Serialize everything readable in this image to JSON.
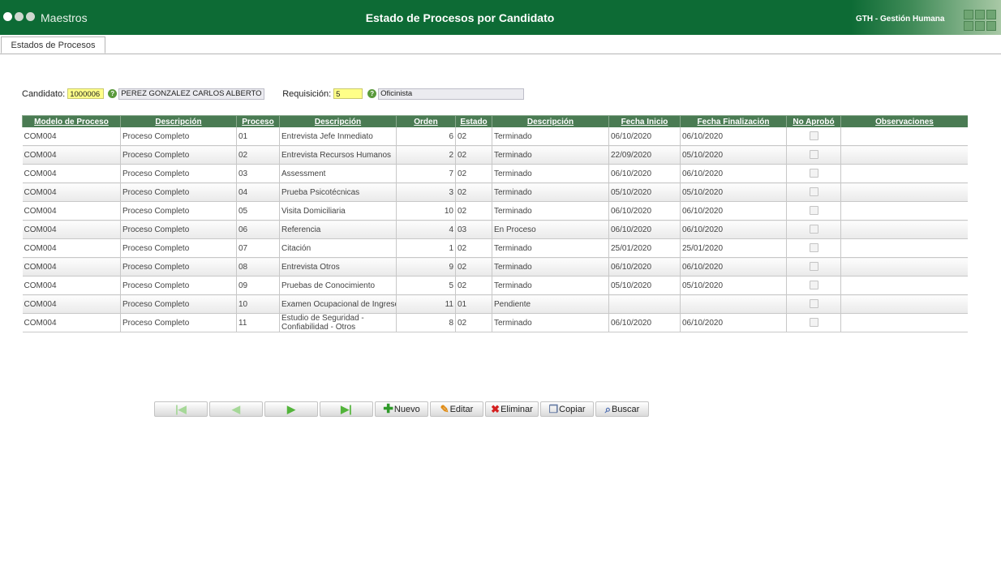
{
  "header": {
    "app_title": "Maestros",
    "page_title": "Estado de Procesos por Candidato",
    "brand": "GTH - Gestión Humana"
  },
  "tabs": [
    {
      "label": "Estados de Procesos"
    }
  ],
  "form": {
    "candidato_label": "Candidato:",
    "candidato_code": "1000006",
    "candidato_name": "PEREZ GONZALEZ CARLOS ALBERTO",
    "requisicion_label": "Requisición:",
    "requisicion_value": "5",
    "requisicion_desc": "Oficinista"
  },
  "grid": {
    "columns": [
      "Modelo de Proceso",
      "Descripción",
      "Proceso",
      "Descripción",
      "Orden",
      "Estado",
      "Descripción",
      "Fecha Inicio",
      "Fecha Finalización",
      "No Aprobó",
      "Observaciones"
    ],
    "rows": [
      {
        "modelo": "COM004",
        "desc_modelo": "Proceso Completo",
        "proceso": "01",
        "desc_proceso": "Entrevista Jefe Inmediato",
        "orden": "6",
        "estado": "02",
        "desc_estado": "Terminado",
        "fecha_inicio": "06/10/2020",
        "fecha_fin": "06/10/2020",
        "no_aprobo": false,
        "observaciones": ""
      },
      {
        "modelo": "COM004",
        "desc_modelo": "Proceso Completo",
        "proceso": "02",
        "desc_proceso": "Entrevista Recursos Humanos",
        "orden": "2",
        "estado": "02",
        "desc_estado": "Terminado",
        "fecha_inicio": "22/09/2020",
        "fecha_fin": "05/10/2020",
        "no_aprobo": false,
        "observaciones": ""
      },
      {
        "modelo": "COM004",
        "desc_modelo": "Proceso Completo",
        "proceso": "03",
        "desc_proceso": "Assessment",
        "orden": "7",
        "estado": "02",
        "desc_estado": "Terminado",
        "fecha_inicio": "06/10/2020",
        "fecha_fin": "06/10/2020",
        "no_aprobo": false,
        "observaciones": ""
      },
      {
        "modelo": "COM004",
        "desc_modelo": "Proceso Completo",
        "proceso": "04",
        "desc_proceso": "Prueba Psicotécnicas",
        "orden": "3",
        "estado": "02",
        "desc_estado": "Terminado",
        "fecha_inicio": "05/10/2020",
        "fecha_fin": "05/10/2020",
        "no_aprobo": false,
        "observaciones": ""
      },
      {
        "modelo": "COM004",
        "desc_modelo": "Proceso Completo",
        "proceso": "05",
        "desc_proceso": "Visita Domiciliaria",
        "orden": "10",
        "estado": "02",
        "desc_estado": "Terminado",
        "fecha_inicio": "06/10/2020",
        "fecha_fin": "06/10/2020",
        "no_aprobo": false,
        "observaciones": ""
      },
      {
        "modelo": "COM004",
        "desc_modelo": "Proceso Completo",
        "proceso": "06",
        "desc_proceso": "Referencia",
        "orden": "4",
        "estado": "03",
        "desc_estado": "En Proceso",
        "fecha_inicio": "06/10/2020",
        "fecha_fin": "06/10/2020",
        "no_aprobo": false,
        "observaciones": ""
      },
      {
        "modelo": "COM004",
        "desc_modelo": "Proceso Completo",
        "proceso": "07",
        "desc_proceso": "Citación",
        "orden": "1",
        "estado": "02",
        "desc_estado": "Terminado",
        "fecha_inicio": "25/01/2020",
        "fecha_fin": "25/01/2020",
        "no_aprobo": false,
        "observaciones": ""
      },
      {
        "modelo": "COM004",
        "desc_modelo": "Proceso Completo",
        "proceso": "08",
        "desc_proceso": "Entrevista Otros",
        "orden": "9",
        "estado": "02",
        "desc_estado": "Terminado",
        "fecha_inicio": "06/10/2020",
        "fecha_fin": "06/10/2020",
        "no_aprobo": false,
        "observaciones": ""
      },
      {
        "modelo": "COM004",
        "desc_modelo": "Proceso Completo",
        "proceso": "09",
        "desc_proceso": "Pruebas de Conocimiento",
        "orden": "5",
        "estado": "02",
        "desc_estado": "Terminado",
        "fecha_inicio": "05/10/2020",
        "fecha_fin": "05/10/2020",
        "no_aprobo": false,
        "observaciones": ""
      },
      {
        "modelo": "COM004",
        "desc_modelo": "Proceso Completo",
        "proceso": "10",
        "desc_proceso": "Examen Ocupacional de Ingreso",
        "orden": "11",
        "estado": "01",
        "desc_estado": "Pendiente",
        "fecha_inicio": "",
        "fecha_fin": "",
        "no_aprobo": false,
        "observaciones": ""
      },
      {
        "modelo": "COM004",
        "desc_modelo": "Proceso Completo",
        "proceso": "11",
        "desc_proceso": "Estudio de Seguridad - Confiabilidad - Otros",
        "orden": "8",
        "estado": "02",
        "desc_estado": "Terminado",
        "fecha_inicio": "06/10/2020",
        "fecha_fin": "06/10/2020",
        "no_aprobo": false,
        "observaciones": ""
      }
    ]
  },
  "toolbar": {
    "nuevo": "Nuevo",
    "editar": "Editar",
    "eliminar": "Eliminar",
    "copiar": "Copiar",
    "buscar": "Buscar"
  },
  "colors": {
    "header_green": "#0d6b35",
    "grid_header": "#4a7b53",
    "input_yellow": "#ffff88"
  }
}
